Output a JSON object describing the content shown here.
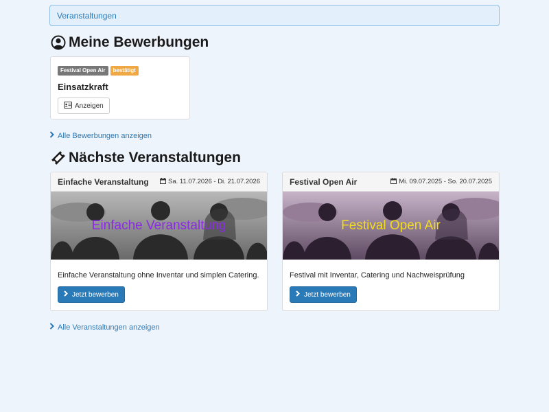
{
  "breadcrumb": {
    "label": "Veranstaltungen"
  },
  "my_applications": {
    "title": "Meine Bewerbungen",
    "icon": "user-circle-icon",
    "items": [
      {
        "event_badge": "Festival Open Air",
        "status_badge": "bestätigt",
        "role": "Einsatzkraft",
        "view_label": "Anzeigen"
      }
    ],
    "show_all_label": "Alle Bewerbungen anzeigen"
  },
  "next_events": {
    "title": "Nächste Veranstaltungen",
    "icon": "ticket-icon",
    "items": [
      {
        "name": "Einfache Veranstaltung",
        "dates": "Sa. 11.07.2026 - Di. 21.07.2026",
        "image_title": "Einfache Veranstaltung",
        "image_title_color": "#8a2be2",
        "image_tint": "gray",
        "description": "Einfache Veranstaltung ohne Inventar und simplen Catering.",
        "apply_label": "Jetzt bewerben"
      },
      {
        "name": "Festival Open Air",
        "dates": "Mi. 09.07.2025 - So. 20.07.2025",
        "image_title": "Festival Open Air",
        "image_title_color": "#f2dc1e",
        "image_tint": "purple",
        "description": "Festival mit Inventar, Catering und Nachweisprüfung",
        "apply_label": "Jetzt bewerben"
      }
    ],
    "show_all_label": "Alle Veranstaltungen anzeigen"
  },
  "colors": {
    "accent": "#2a7ab8",
    "background": "#eef4fc",
    "badge_gray": "#777777",
    "badge_orange": "#f0a844"
  }
}
